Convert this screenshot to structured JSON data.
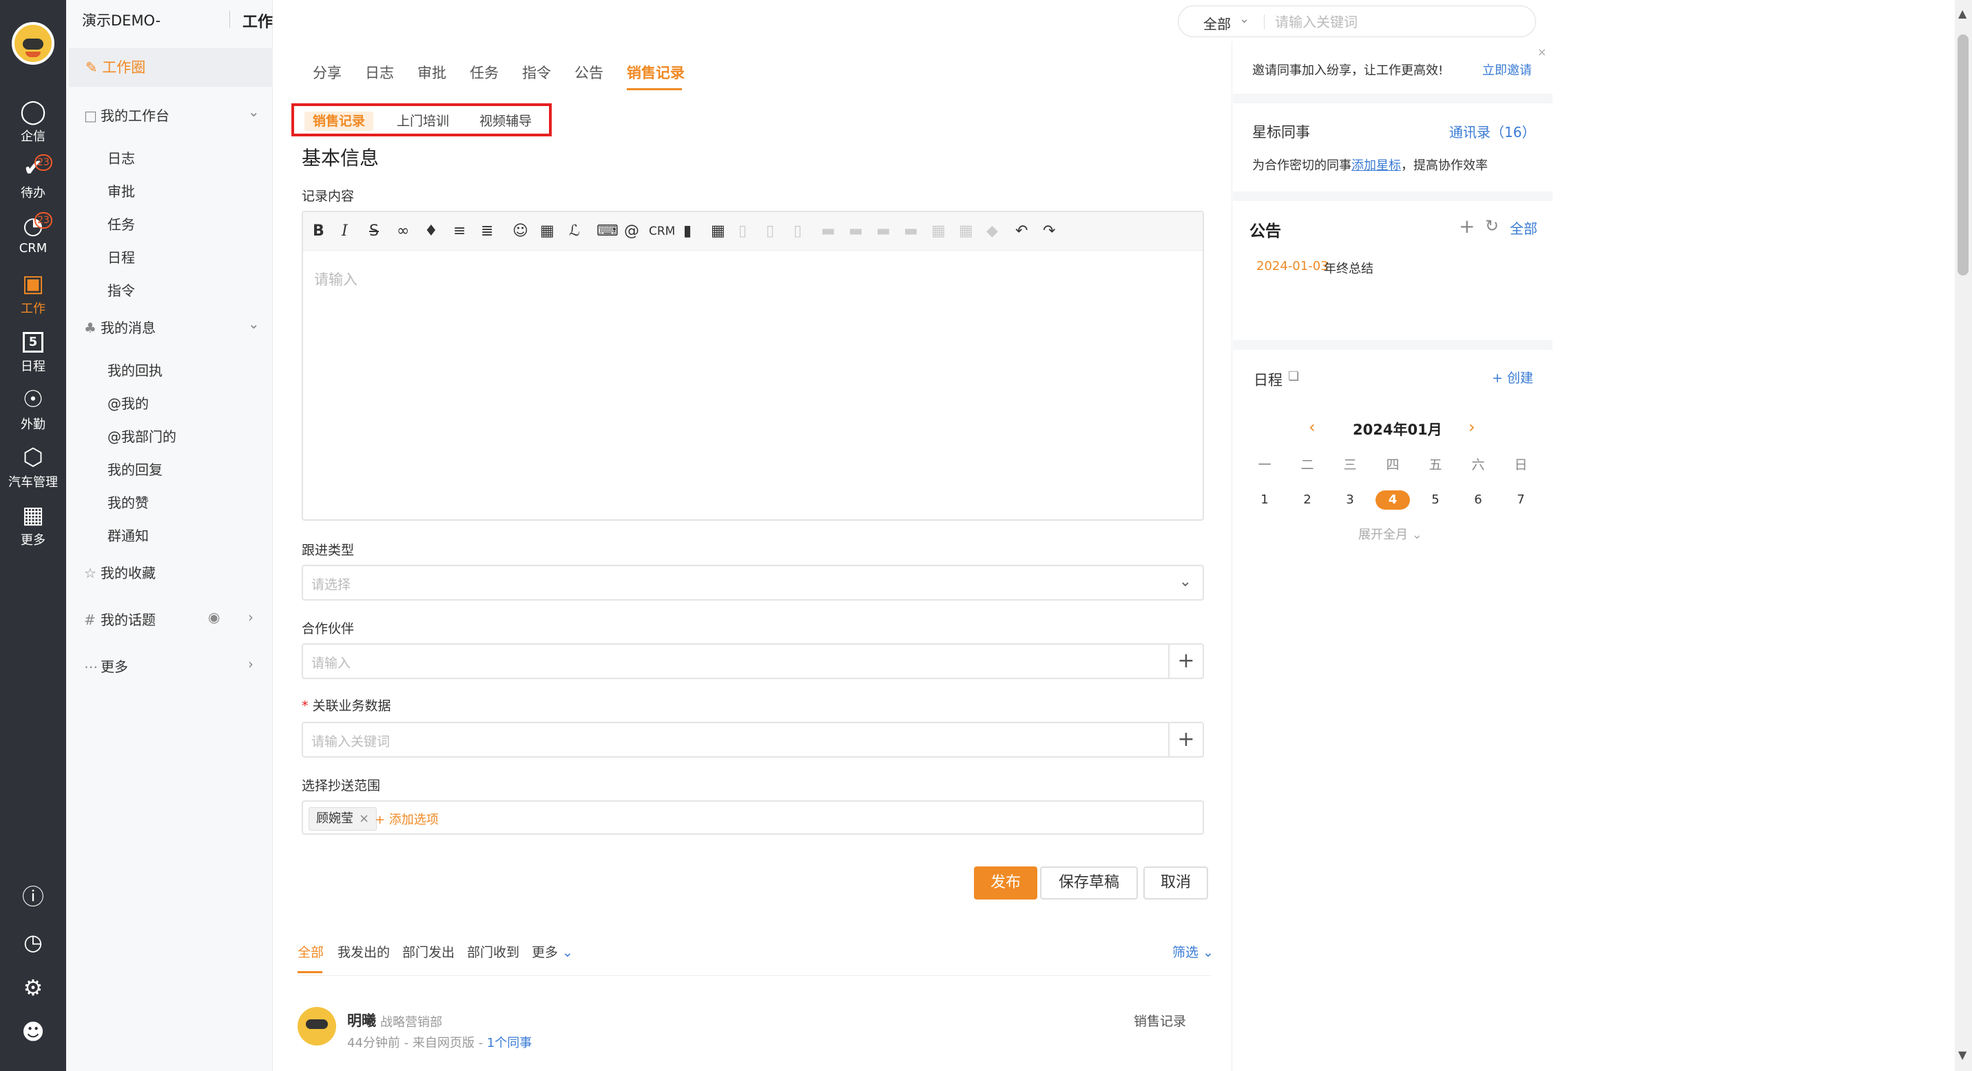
{
  "header": {
    "company": "演示DEMO-",
    "section": "工作"
  },
  "search": {
    "scope": "全部",
    "placeholder": "请输入关键词"
  },
  "rail": {
    "items": [
      {
        "label": "企信",
        "icon": "chat-bubble-icon"
      },
      {
        "label": "待办",
        "icon": "check-circle-icon",
        "badge": "23"
      },
      {
        "label": "CRM",
        "icon": "pie-chart-icon",
        "badge": "23"
      },
      {
        "label": "工作",
        "icon": "briefcase-icon"
      },
      {
        "label": "日程",
        "icon": "calendar-icon",
        "date": "5"
      },
      {
        "label": "外勤",
        "icon": "location-pin-icon"
      },
      {
        "label": "汽车管理",
        "icon": "cube-icon"
      },
      {
        "label": "更多",
        "icon": "grid-icon"
      }
    ]
  },
  "sidebar": {
    "circle": "工作圈",
    "workbench": "我的工作台",
    "workbench_items": [
      "日志",
      "审批",
      "任务",
      "日程",
      "指令"
    ],
    "messages": "我的消息",
    "message_items": [
      "我的回执",
      "@我的",
      "@我部门的",
      "我的回复",
      "我的赞",
      "群通知"
    ],
    "favorites": "我的收藏",
    "topics": "我的话题",
    "more": "更多"
  },
  "tabs": [
    "分享",
    "日志",
    "审批",
    "任务",
    "指令",
    "公告",
    "销售记录"
  ],
  "subtabs": [
    "销售记录",
    "上门培训",
    "视频辅导"
  ],
  "form": {
    "section_title": "基本信息",
    "content_label": "记录内容",
    "content_placeholder": "请输入",
    "follow_label": "跟进类型",
    "follow_placeholder": "请选择",
    "partner_label": "合作伙伴",
    "partner_placeholder": "请输入",
    "biz_label": "关联业务数据",
    "biz_placeholder": "请输入关键词",
    "cc_label": "选择抄送范围",
    "cc_tag": "顾婉莹",
    "cc_add": "+ 添加选项",
    "toolbar_crm": "CRM"
  },
  "buttons": {
    "publish": "发布",
    "draft": "保存草稿",
    "cancel": "取消"
  },
  "feed": {
    "tabs": [
      "全部",
      "我发出的",
      "部门发出",
      "部门收到",
      "更多"
    ],
    "filter": "筛选",
    "post": {
      "name": "明曦",
      "dept": "战略营销部",
      "meta": "44分钟前 - 来自网页版 - ",
      "link": "1个同事",
      "type": "销售记录"
    }
  },
  "right": {
    "invite_text": "邀请同事加入纷享，让工作更高效!",
    "invite_link": "立即邀请",
    "star_title": "星标同事",
    "star_link": "通讯录（16）",
    "star_desc_pre": "为合作密切的同事",
    "star_desc_link": "添加星标",
    "star_desc_post": "，提高协作效率",
    "notice_title": "公告",
    "notice_all": "全部",
    "notice_date": "2024-01-03",
    "notice_text": "年终总结",
    "schedule_title": "日程",
    "schedule_create": "+ 创建",
    "calendar_month": "2024年01月",
    "weekdays": [
      "一",
      "二",
      "三",
      "四",
      "五",
      "六",
      "日"
    ],
    "days": [
      "1",
      "2",
      "3",
      "4",
      "5",
      "6",
      "7"
    ],
    "today": "4",
    "expand": "展开全月"
  },
  "colors": {
    "accent": "#f08a24",
    "link": "#3a7bd5",
    "rail": "#2f3238",
    "highlight_box": "#e62020"
  }
}
